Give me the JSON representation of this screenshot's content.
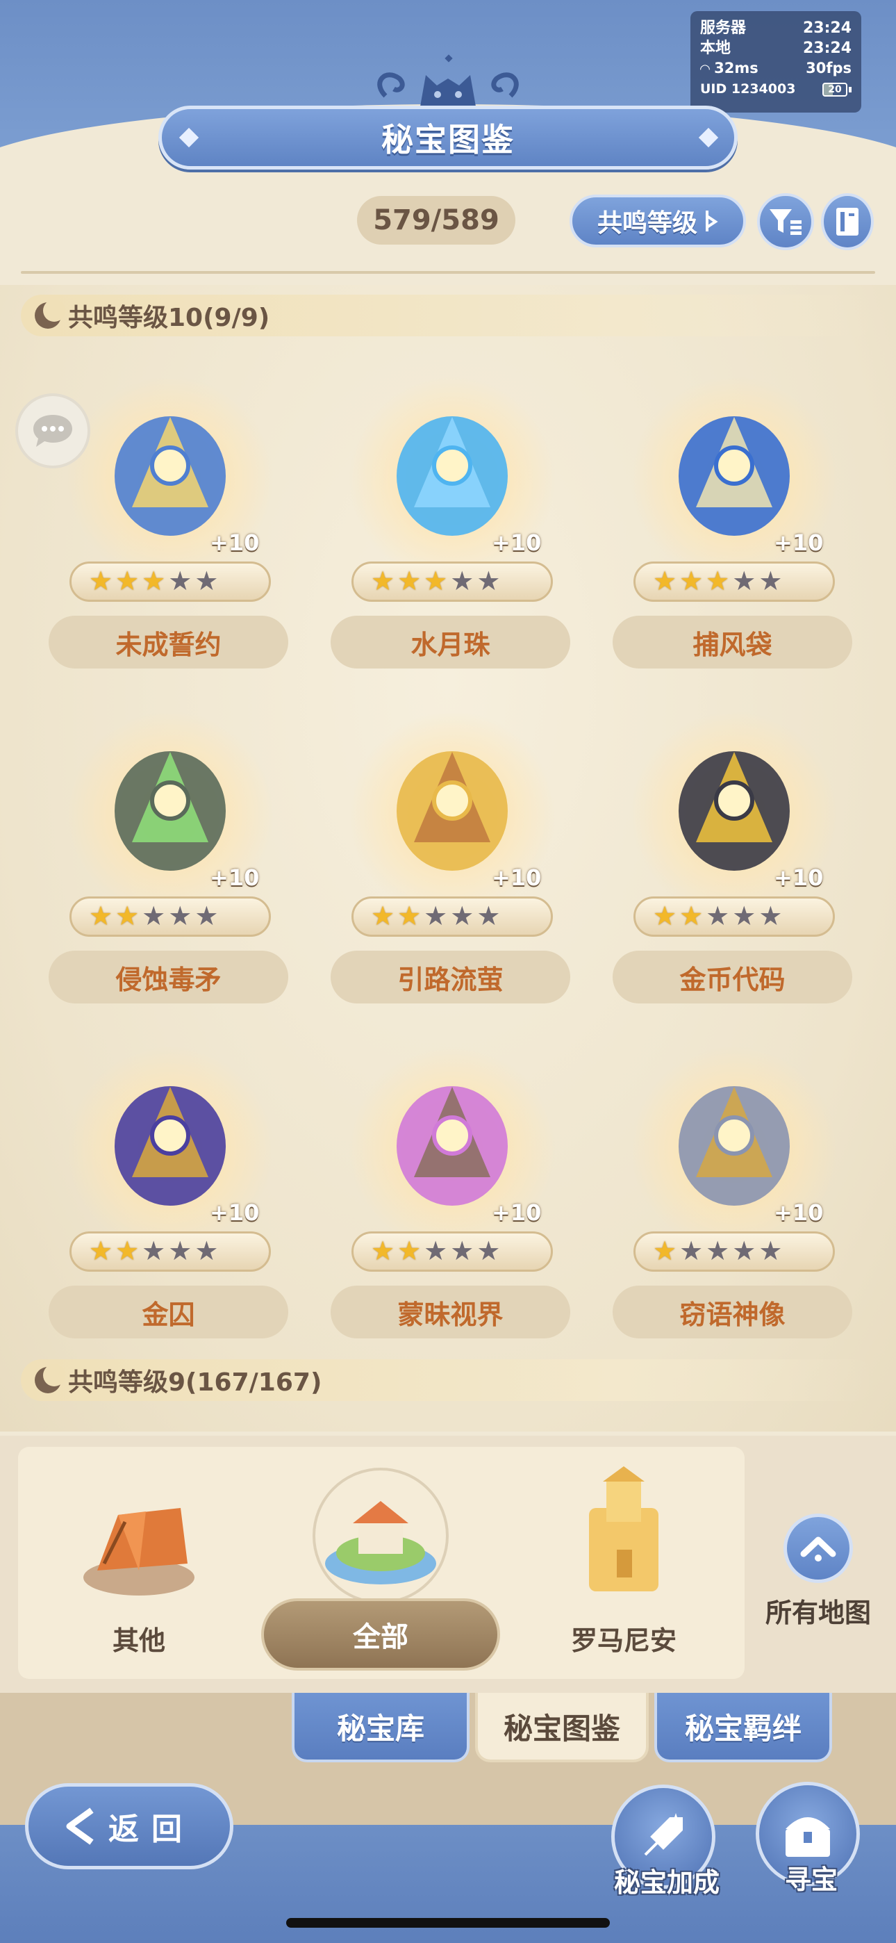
{
  "status": {
    "server_label": "服务器",
    "server_time": "23:24",
    "local_label": "本地",
    "local_time": "23:24",
    "ping": "32ms",
    "fps": "30fps",
    "uid": "UID 1234003",
    "battery": "20"
  },
  "header": {
    "title": "秘宝图鉴",
    "count": "579/589",
    "resonance_filter_label": "共鸣等级",
    "filter_icon": "filter-icon",
    "book_icon": "book-icon"
  },
  "sections": [
    {
      "title": "共鸣等级10(9/9)",
      "items": [
        {
          "name": "未成誓约",
          "plus": "+10",
          "stars": 3,
          "max_stars": 5
        },
        {
          "name": "水月珠",
          "plus": "+10",
          "stars": 3,
          "max_stars": 5
        },
        {
          "name": "捕风袋",
          "plus": "+10",
          "stars": 3,
          "max_stars": 5
        },
        {
          "name": "侵蚀毒矛",
          "plus": "+10",
          "stars": 2,
          "max_stars": 5
        },
        {
          "name": "引路流萤",
          "plus": "+10",
          "stars": 2,
          "max_stars": 5
        },
        {
          "name": "金币代码",
          "plus": "+10",
          "stars": 2,
          "max_stars": 5
        },
        {
          "name": "金囚",
          "plus": "+10",
          "stars": 2,
          "max_stars": 5
        },
        {
          "name": "蒙昧视界",
          "plus": "+10",
          "stars": 2,
          "max_stars": 5
        },
        {
          "name": "窃语神像",
          "plus": "+10",
          "stars": 1,
          "max_stars": 5
        }
      ]
    },
    {
      "title": "共鸣等级9(167/167)"
    }
  ],
  "regions": {
    "other": "其他",
    "all": "全部",
    "romanian": "罗马尼安",
    "all_maps": "所有地图"
  },
  "tabs": {
    "vault": "秘宝库",
    "codex": "秘宝图鉴",
    "bonds": "秘宝羁绊"
  },
  "bottom": {
    "back": "返回",
    "bonus": "秘宝加成",
    "treasure_hunt": "寻宝"
  },
  "colors": {
    "accent_blue": "#6d8fc6",
    "item_name": "#c0692c",
    "star_on": "#f2b82a",
    "star_off": "#6f6a74"
  }
}
